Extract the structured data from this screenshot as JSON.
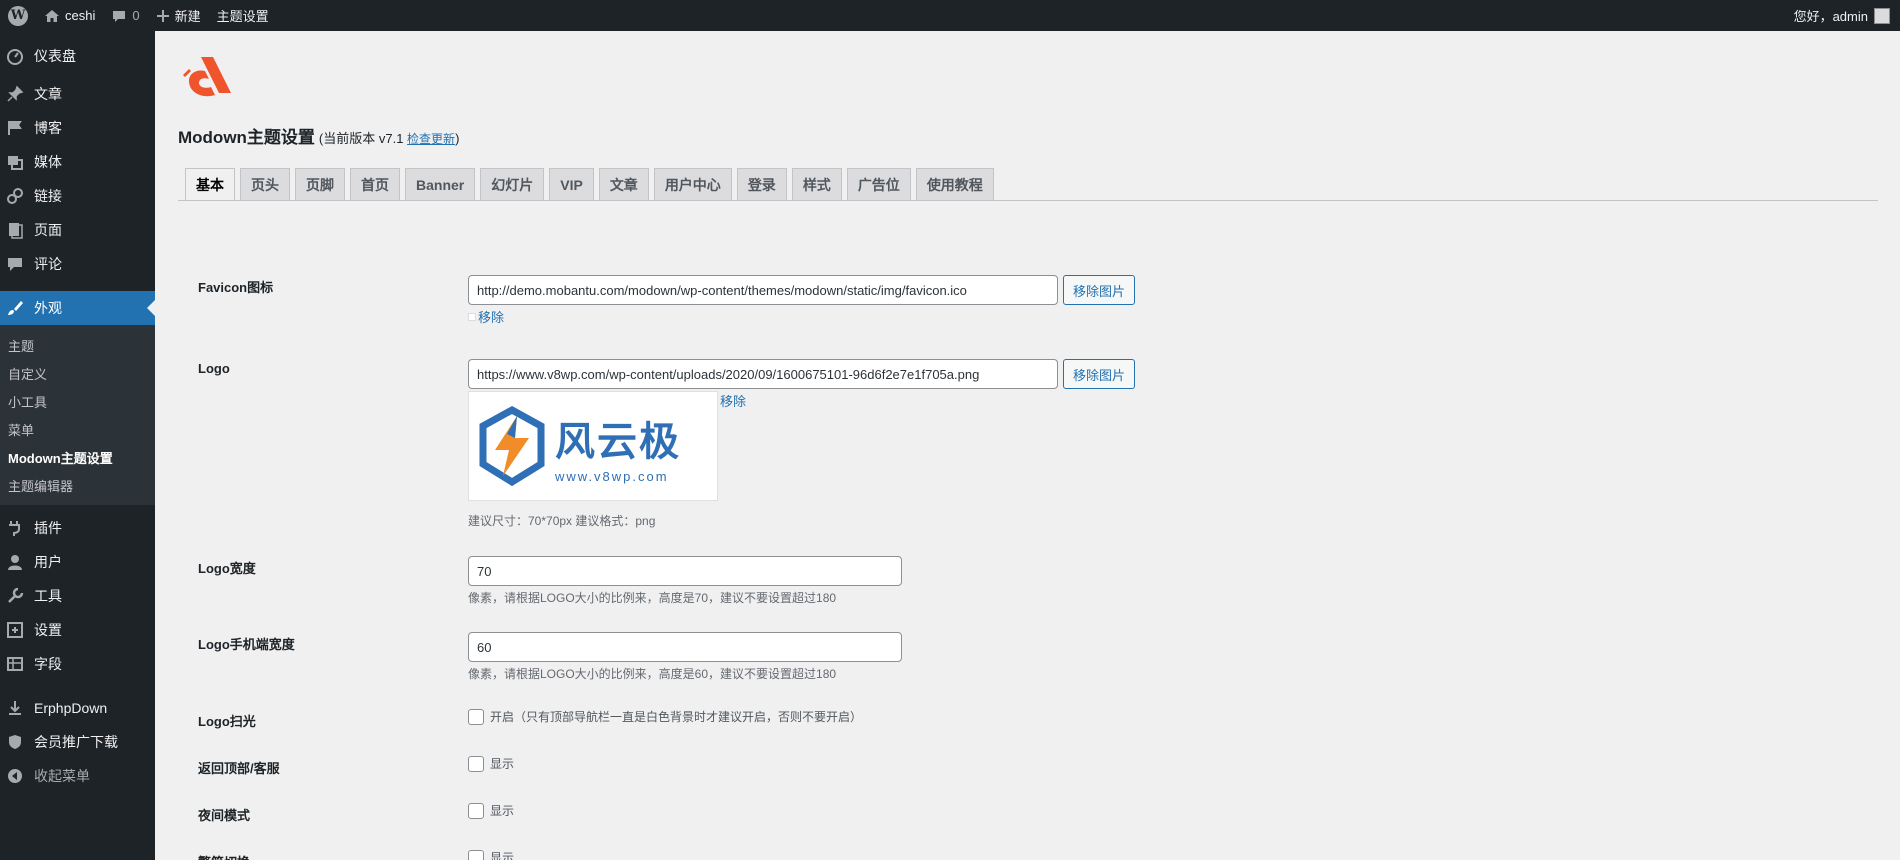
{
  "adminbar": {
    "site_name": "ceshi",
    "comments_count": "0",
    "new_label": "新建",
    "theme_settings_label": "主题设置",
    "greeting": "您好，admin"
  },
  "sidebar": {
    "items_top": [
      {
        "label": "仪表盘",
        "icon": "dashboard-icon"
      },
      {
        "label": "文章",
        "icon": "pin-icon"
      },
      {
        "label": "博客",
        "icon": "flag-icon"
      },
      {
        "label": "媒体",
        "icon": "media-icon"
      },
      {
        "label": "链接",
        "icon": "link-icon"
      },
      {
        "label": "页面",
        "icon": "page-icon"
      },
      {
        "label": "评论",
        "icon": "comment-icon"
      }
    ],
    "current": {
      "label": "外观",
      "icon": "brush-icon"
    },
    "submenu": [
      "主题",
      "自定义",
      "小工具",
      "菜单",
      "Modown主题设置",
      "主题编辑器"
    ],
    "submenu_active": "Modown主题设置",
    "items_bottom": [
      {
        "label": "插件",
        "icon": "plugin-icon"
      },
      {
        "label": "用户",
        "icon": "user-icon"
      },
      {
        "label": "工具",
        "icon": "wrench-icon"
      },
      {
        "label": "设置",
        "icon": "settings-icon"
      },
      {
        "label": "字段",
        "icon": "fields-icon"
      }
    ],
    "items_extra": [
      {
        "label": "ErphpDown",
        "icon": "erphpdown-icon"
      },
      {
        "label": "会员推广下载",
        "icon": "shield-icon"
      },
      {
        "label": "收起菜单",
        "icon": "collapse-icon"
      }
    ]
  },
  "page": {
    "title": "Modown主题设置",
    "version_prefix": "(当前版本 v7.1 ",
    "check_update": "检查更新",
    "version_suffix": ")",
    "brand_color": "#f0542d"
  },
  "tabs": [
    "基本",
    "页头",
    "页脚",
    "首页",
    "Banner",
    "幻灯片",
    "VIP",
    "文章",
    "用户中心",
    "登录",
    "样式",
    "广告位",
    "使用教程"
  ],
  "active_tab": "基本",
  "form": {
    "favicon": {
      "label": "Favicon图标",
      "value": "http://demo.mobantu.com/modown/wp-content/themes/modown/static/img/favicon.ico",
      "remove_button": "移除图片",
      "remove_link": "移除"
    },
    "logo": {
      "label": "Logo",
      "value": "https://www.v8wp.com/wp-content/uploads/2020/09/1600675101-96d6f2e7e1f705a.png",
      "remove_button": "移除图片",
      "remove_link": "移除",
      "preview_title": "风云极",
      "preview_url": "www.v8wp.com",
      "hint": "建议尺寸：70*70px 建议格式：png"
    },
    "logo_width": {
      "label": "Logo宽度",
      "value": "70",
      "desc": "像素，请根据LOGO大小的比例来，高度是70，建议不要设置超过180"
    },
    "logo_mobile_width": {
      "label": "Logo手机端宽度",
      "value": "60",
      "desc": "像素，请根据LOGO大小的比例来，高度是60，建议不要设置超过180"
    },
    "logo_shine": {
      "label": "Logo扫光",
      "checkbox_text": "开启（只有顶部导航栏一直是白色背景时才建议开启，否则不要开启）"
    },
    "back_top": {
      "label": "返回顶部/客服",
      "checkbox_text": "显示"
    },
    "night_mode": {
      "label": "夜间模式",
      "checkbox_text": "显示"
    },
    "trad_switch": {
      "label": "繁简切换",
      "checkbox_text": "显示"
    }
  }
}
